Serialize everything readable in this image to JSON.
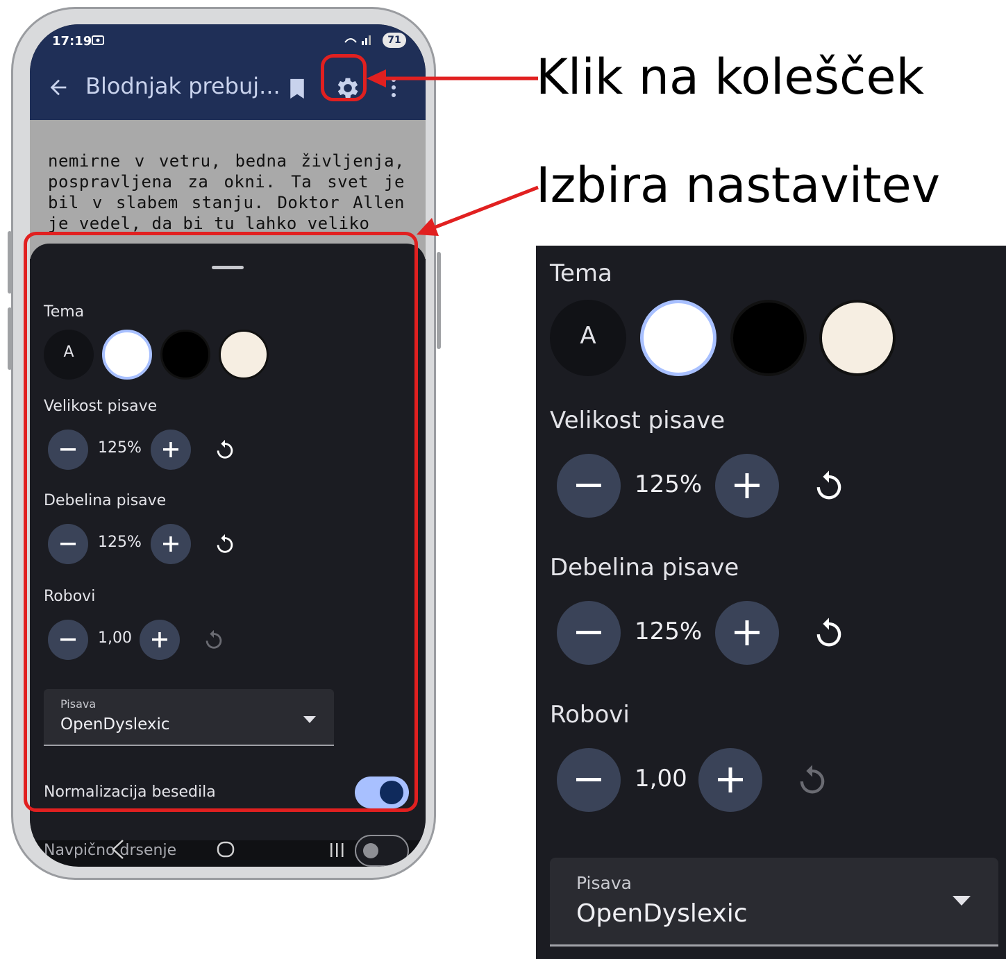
{
  "annotations": {
    "click_gear": "Klik na kolešček",
    "choose_settings": "Izbira nastavitev"
  },
  "status_bar": {
    "time": "17:19",
    "battery": "71"
  },
  "app_bar": {
    "title": "Blodnjak prebuj..."
  },
  "reading_text": "nemirne v vetru, bedna življenja, pospravljena za okni. Ta svet je bil v slabem stanju. Doktor Allen je vedel, da bi tu lahko veliko",
  "settings": {
    "theme": {
      "label": "Tema",
      "auto_label": "A",
      "options": [
        "auto",
        "white",
        "black",
        "sepia"
      ],
      "selected": "white"
    },
    "font_size": {
      "label": "Velikost pisave",
      "value": "125%"
    },
    "font_weight": {
      "label": "Debelina pisave",
      "value": "125%"
    },
    "margins": {
      "label": "Robovi",
      "value": "1,00"
    },
    "font": {
      "label": "Pisava",
      "value": "OpenDyslexic"
    },
    "normalize_text": {
      "label": "Normalizacija besedila",
      "enabled": true
    },
    "vertical_scroll": {
      "label": "Navpično drsenje",
      "enabled": false
    }
  },
  "colors": {
    "app_bar": "#1f2f57",
    "sheet_bg": "#1b1c22",
    "round_button": "#3a4358",
    "accent": "#a8c0ff",
    "highlight": "#e12020"
  }
}
